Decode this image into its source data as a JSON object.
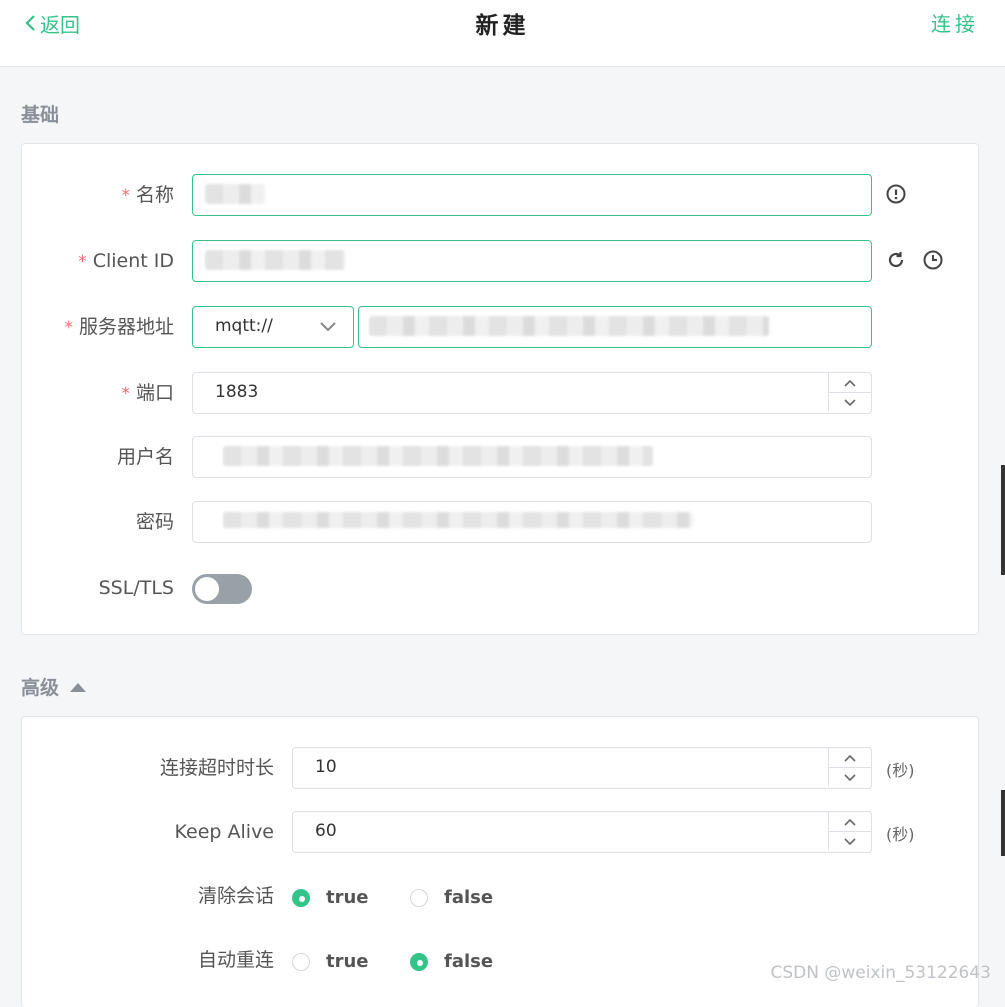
{
  "header": {
    "back_label": "返回",
    "title": "新建",
    "connect_label": "连接"
  },
  "basic": {
    "section_title": "基础",
    "fields": {
      "name": {
        "label": "名称",
        "required_mark": "*",
        "value": ""
      },
      "client_id": {
        "label": "Client ID",
        "required_mark": "*",
        "value": ""
      },
      "server": {
        "label": "服务器地址",
        "required_mark": "*",
        "protocol": "mqtt://",
        "host": ""
      },
      "port": {
        "label": "端口",
        "required_mark": "*",
        "value": "1883"
      },
      "username": {
        "label": "用户名",
        "value": ""
      },
      "password": {
        "label": "密码",
        "value": ""
      },
      "ssl": {
        "label": "SSL/TLS",
        "enabled": false
      }
    }
  },
  "advanced": {
    "section_title": "高级",
    "fields": {
      "timeout": {
        "label": "连接超时时长",
        "value": "10",
        "unit": "(秒)"
      },
      "keep_alive": {
        "label": "Keep Alive",
        "value": "60",
        "unit": "(秒)"
      },
      "clean_session": {
        "label": "清除会话",
        "options": [
          "true",
          "false"
        ],
        "selected": "true"
      },
      "auto_reconnect": {
        "label": "自动重连",
        "options": [
          "true",
          "false"
        ],
        "selected": "false"
      }
    }
  },
  "watermark": "CSDN @weixin_53122643",
  "colors": {
    "accent": "#34c388",
    "required": "#f56c6c",
    "switch_off": "#9aa0a8"
  }
}
